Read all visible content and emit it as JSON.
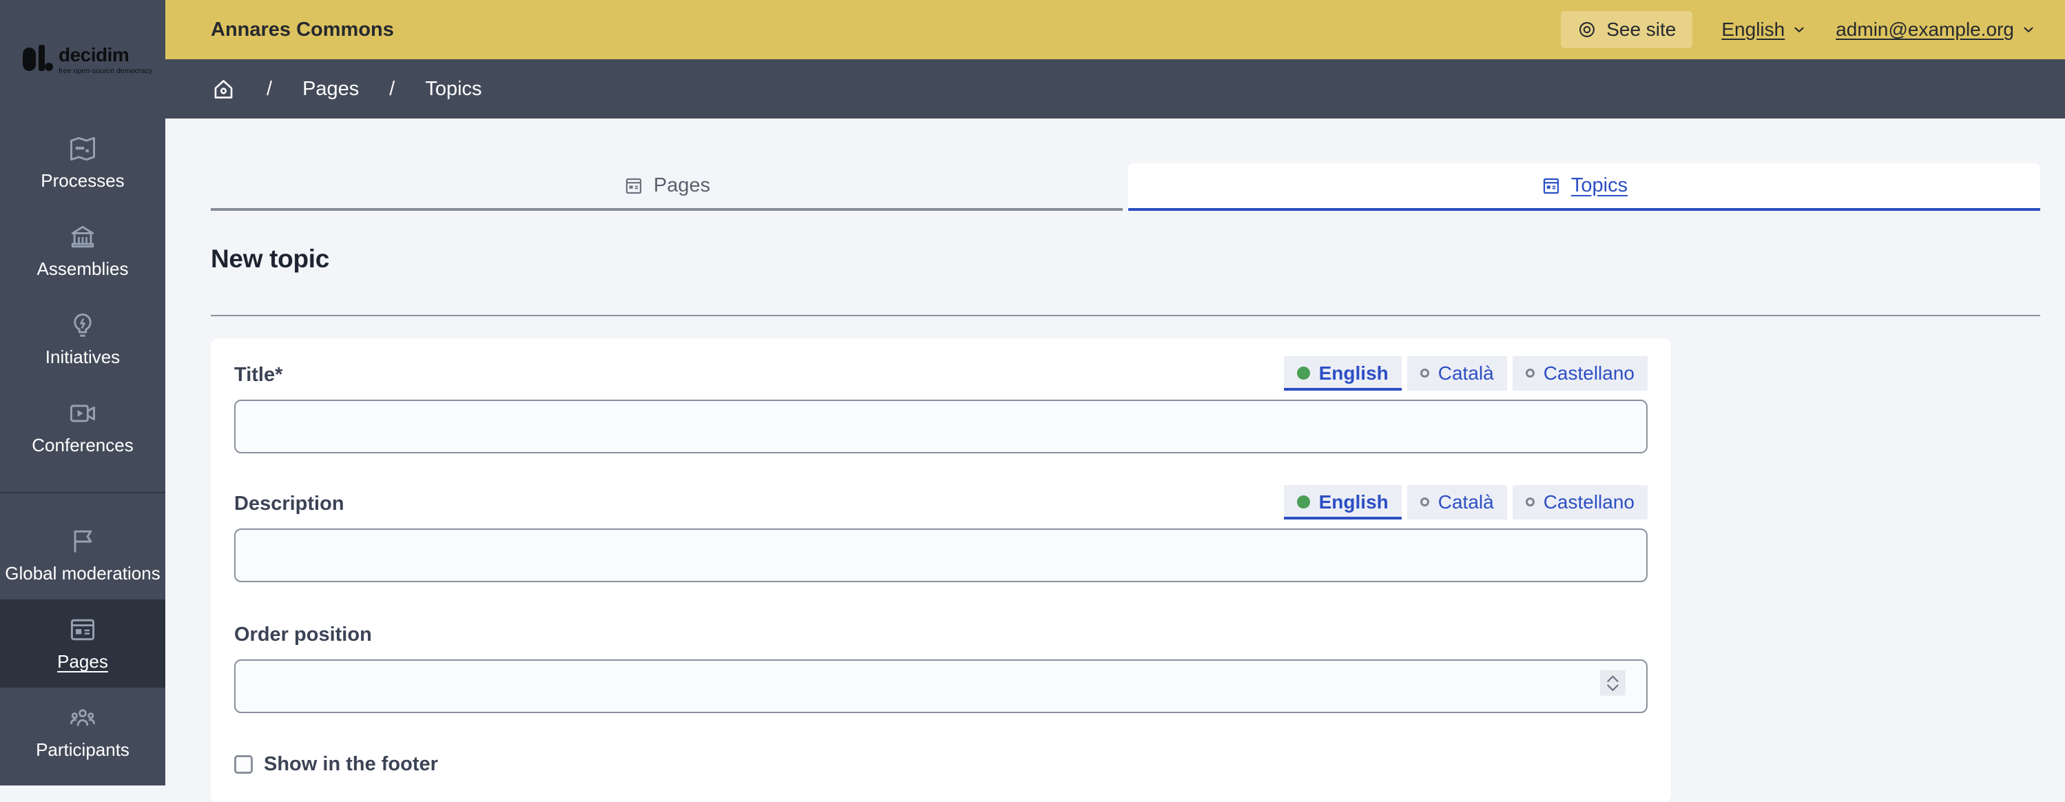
{
  "brand": {
    "name": "decidim",
    "tagline": "free open-source democracy"
  },
  "topbar": {
    "title": "Annares Commons",
    "see_site_label": "See site",
    "language_label": "English",
    "user_label": "admin@example.org"
  },
  "sidebar": {
    "items": [
      {
        "label": "Processes",
        "icon": "map-icon"
      },
      {
        "label": "Assemblies",
        "icon": "bank-icon"
      },
      {
        "label": "Initiatives",
        "icon": "lightbulb-icon"
      },
      {
        "label": "Conferences",
        "icon": "video-icon"
      },
      {
        "label": "Global moderations",
        "icon": "flag-icon"
      },
      {
        "label": "Pages",
        "icon": "newspaper-icon",
        "active": true
      },
      {
        "label": "Participants",
        "icon": "team-icon"
      }
    ]
  },
  "breadcrumb": {
    "separator": "/",
    "items": [
      {
        "label": "Pages"
      },
      {
        "label": "Topics"
      }
    ]
  },
  "tabs": [
    {
      "label": "Pages",
      "active": false
    },
    {
      "label": "Topics",
      "active": true
    }
  ],
  "page": {
    "heading": "New topic"
  },
  "form": {
    "languages": [
      {
        "label": "English",
        "selected": true
      },
      {
        "label": "Català",
        "selected": false
      },
      {
        "label": "Castellano",
        "selected": false
      }
    ],
    "fields": {
      "title": {
        "label": "Title*",
        "value": ""
      },
      "description": {
        "label": "Description",
        "value": ""
      },
      "order_position": {
        "label": "Order position",
        "value": ""
      }
    },
    "show_in_footer": {
      "label": "Show in the footer",
      "checked": false
    }
  },
  "colors": {
    "topbar_yellow": "#dcc35f",
    "sidebar_slate": "#434b5a",
    "active_item": "#2c333f",
    "accent_blue": "#2c4fc3",
    "radio_green": "#4a9e55",
    "content_bg": "#f4f5f8"
  }
}
